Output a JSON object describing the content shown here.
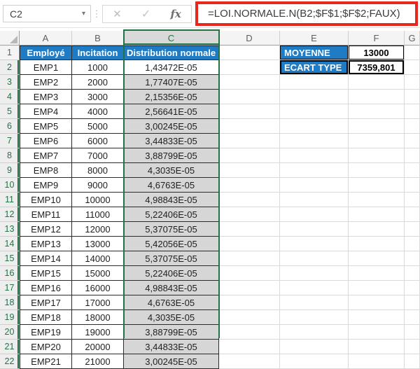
{
  "formula_bar": {
    "cell_reference": "C2",
    "formula": "=LOI.NORMALE.N(B2;$F$1;$F$2;FAUX)",
    "fx_label": "fx",
    "cancel_icon": "✕",
    "enter_icon": "✓",
    "dots_icon": "⋮",
    "dropdown_icon": "▾"
  },
  "colors": {
    "header_blue": "#1F7BC4",
    "selection_green": "#217346",
    "selection_fill": "#D6D6D6",
    "formula_highlight_red": "#E8281E"
  },
  "sheet": {
    "column_headers": [
      "A",
      "B",
      "C",
      "D",
      "E",
      "F",
      "G"
    ],
    "selected_column": "C",
    "selected_rows_start": 2,
    "table": {
      "headers": [
        "Employé",
        "Incitation",
        "Distribution normale"
      ],
      "rows": [
        {
          "employe": "EMP1",
          "incitation": "1000",
          "distribution": "1,43472E-05"
        },
        {
          "employe": "EMP2",
          "incitation": "2000",
          "distribution": "1,77407E-05"
        },
        {
          "employe": "EMP3",
          "incitation": "3000",
          "distribution": "2,15356E-05"
        },
        {
          "employe": "EMP4",
          "incitation": "4000",
          "distribution": "2,56641E-05"
        },
        {
          "employe": "EMP5",
          "incitation": "5000",
          "distribution": "3,00245E-05"
        },
        {
          "employe": "EMP6",
          "incitation": "6000",
          "distribution": "3,44833E-05"
        },
        {
          "employe": "EMP7",
          "incitation": "7000",
          "distribution": "3,88799E-05"
        },
        {
          "employe": "EMP8",
          "incitation": "8000",
          "distribution": "4,3035E-05"
        },
        {
          "employe": "EMP9",
          "incitation": "9000",
          "distribution": "4,6763E-05"
        },
        {
          "employe": "EMP10",
          "incitation": "10000",
          "distribution": "4,98843E-05"
        },
        {
          "employe": "EMP11",
          "incitation": "11000",
          "distribution": "5,22406E-05"
        },
        {
          "employe": "EMP12",
          "incitation": "12000",
          "distribution": "5,37075E-05"
        },
        {
          "employe": "EMP13",
          "incitation": "13000",
          "distribution": "5,42056E-05"
        },
        {
          "employe": "EMP14",
          "incitation": "14000",
          "distribution": "5,37075E-05"
        },
        {
          "employe": "EMP15",
          "incitation": "15000",
          "distribution": "5,22406E-05"
        },
        {
          "employe": "EMP16",
          "incitation": "16000",
          "distribution": "4,98843E-05"
        },
        {
          "employe": "EMP17",
          "incitation": "17000",
          "distribution": "4,6763E-05"
        },
        {
          "employe": "EMP18",
          "incitation": "18000",
          "distribution": "4,3035E-05"
        },
        {
          "employe": "EMP19",
          "incitation": "19000",
          "distribution": "3,88799E-05"
        },
        {
          "employe": "EMP20",
          "incitation": "20000",
          "distribution": "3,44833E-05"
        },
        {
          "employe": "EMP21",
          "incitation": "21000",
          "distribution": "3,00245E-05"
        }
      ]
    },
    "stats": {
      "rows": [
        {
          "label": "MOYENNE",
          "value": "13000"
        },
        {
          "label": "ECART TYPE",
          "value": "7359,801"
        }
      ]
    }
  }
}
